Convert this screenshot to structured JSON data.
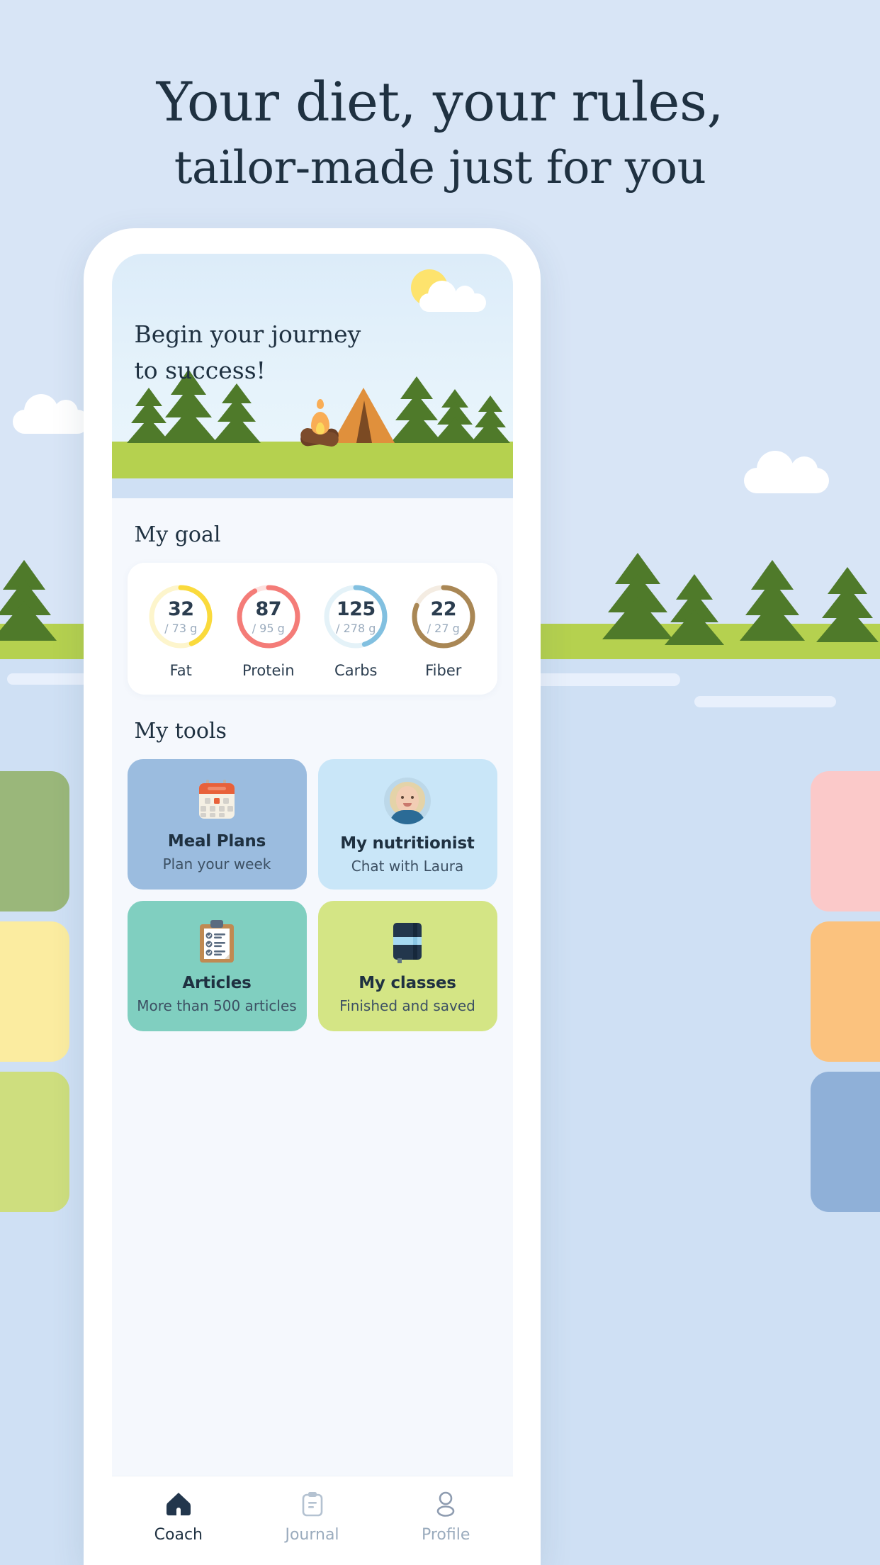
{
  "promo": {
    "headline_line1": "Your diet, your rules,",
    "headline_line2": "tailor-made just for you",
    "bg_color": "#d8e5f6",
    "text_color": "#1f3141"
  },
  "hero": {
    "title_line1": "Begin your journey",
    "title_line2": "to success!",
    "sun_icon": "sun-icon",
    "cloud_icon": "cloud-icon",
    "tent_icon": "tent-icon",
    "campfire_icon": "campfire-icon",
    "tree_icon": "pine-tree-icon"
  },
  "goal": {
    "title": "My goal",
    "macros": [
      {
        "label": "Fat",
        "value": "32",
        "goal": "/ 73 g",
        "current": 32,
        "target": 73,
        "color": "#fada3c",
        "track": "#fdf5cc",
        "pct": 44
      },
      {
        "label": "Protein",
        "value": "87",
        "goal": "/ 95 g",
        "current": 87,
        "target": 95,
        "color": "#f47c78",
        "track": "#fde2e0",
        "pct": 92
      },
      {
        "label": "Carbs",
        "value": "125",
        "goal": "/ 278 g",
        "current": 125,
        "target": 278,
        "color": "#82c0e0",
        "track": "#e4f2f8",
        "pct": 45
      },
      {
        "label": "Fiber",
        "value": "22",
        "goal": "/ 27 g",
        "current": 22,
        "target": 27,
        "color": "#a98755",
        "track": "#f4ece2",
        "pct": 81
      }
    ]
  },
  "tools": {
    "title": "My tools",
    "cards": [
      {
        "title": "Meal Plans",
        "subtitle": "Plan your week",
        "bg": "#9bbcdf",
        "icon": "calendar-icon"
      },
      {
        "title": "My nutritionist",
        "subtitle": "Chat with Laura",
        "bg": "#c9e6f8",
        "icon": "nutritionist-avatar"
      },
      {
        "title": "Articles",
        "subtitle": "More than 500 articles",
        "bg": "#80cfc0",
        "icon": "clipboard-checklist-icon"
      },
      {
        "title": "My classes",
        "subtitle": "Finished and saved",
        "bg": "#d4e585",
        "icon": "notebook-icon"
      }
    ]
  },
  "bottom_nav": {
    "items": [
      {
        "label": "Coach",
        "icon": "home-icon",
        "active": true
      },
      {
        "label": "Journal",
        "icon": "clipboard-icon",
        "active": false
      },
      {
        "label": "Profile",
        "icon": "person-icon",
        "active": false
      }
    ]
  }
}
